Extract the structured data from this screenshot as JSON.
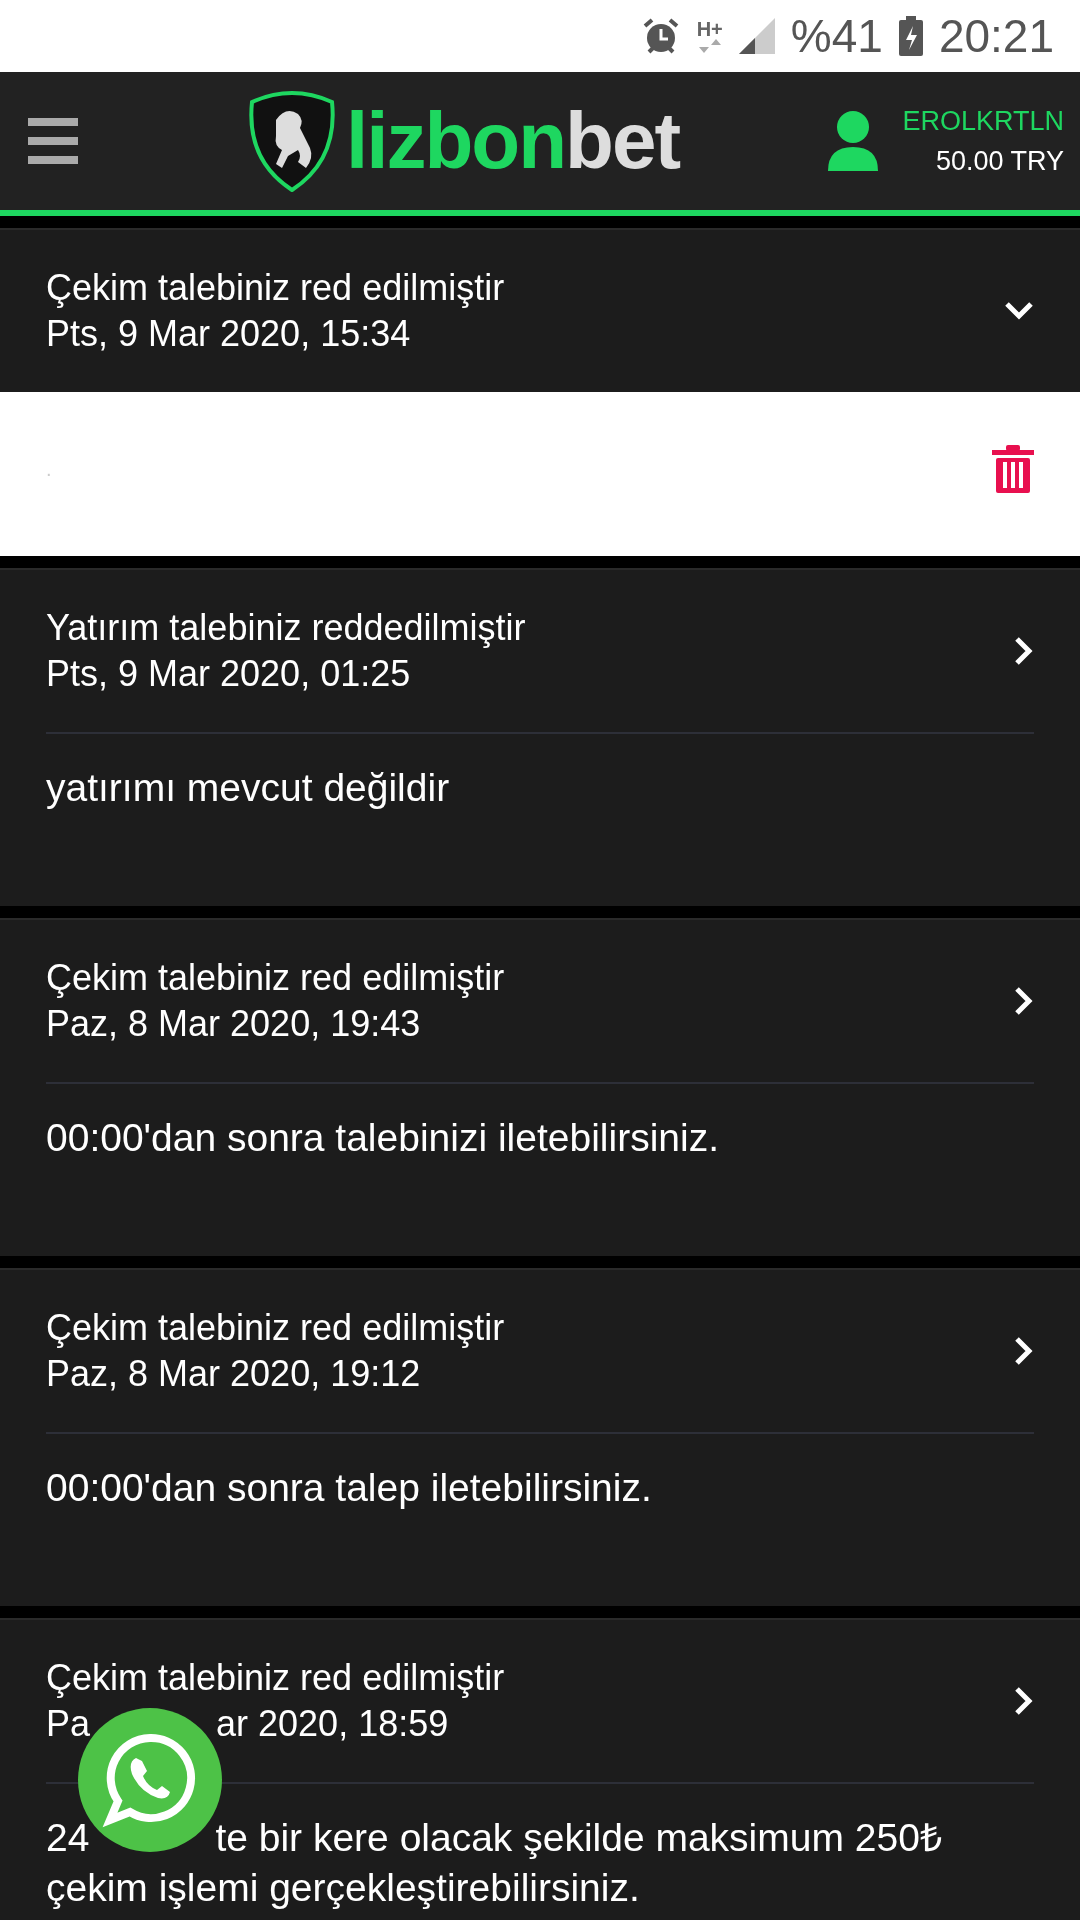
{
  "status_bar": {
    "network": "H+",
    "battery": "%41",
    "time": "20:21"
  },
  "header": {
    "logo_parts": [
      "lizbon",
      "bet"
    ],
    "username": "EROLKRTLN",
    "balance": "50.00 TRY"
  },
  "messages": [
    {
      "title": "Çekim talebiniz red edilmiştir",
      "date": "Pts, 9 Mar 2020, 15:34",
      "expanded": true,
      "body": "."
    },
    {
      "title": "Yatırım talebiniz reddedilmiştir",
      "date": "Pts, 9 Mar 2020, 01:25",
      "expanded": false,
      "body": "yatırımı mevcut değildir"
    },
    {
      "title": "Çekim talebiniz red edilmiştir",
      "date": "Paz, 8 Mar 2020, 19:43",
      "expanded": false,
      "body": "00:00'dan sonra talebinizi iletebilirsiniz."
    },
    {
      "title": "Çekim talebiniz red edilmiştir",
      "date": "Paz, 8 Mar 2020, 19:12",
      "expanded": false,
      "body": "00:00'dan sonra talep iletebilirsiniz."
    },
    {
      "title": "Çekim talebiniz red edilmiştir",
      "date": [
        "Pa",
        "ar 2020, 18:59"
      ],
      "expanded": false,
      "body": [
        [
          "24",
          "te bir kere olacak şekilde maksimum 250₺"
        ],
        [
          "çekim işlemi gerçekleştirebilirsiniz."
        ]
      ]
    }
  ]
}
